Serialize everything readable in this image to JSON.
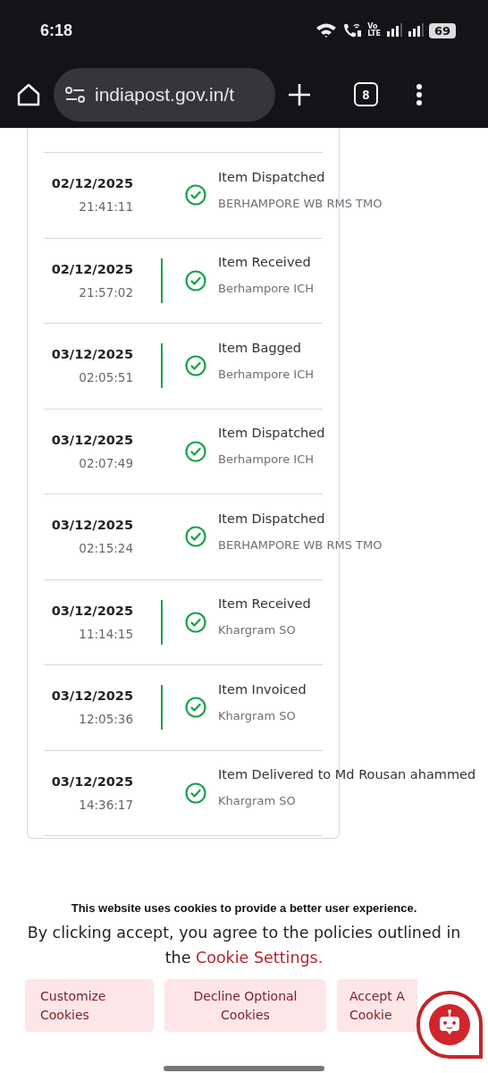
{
  "status_bar": {
    "time": "6:18",
    "volte_top": "Vo",
    "volte_bottom": "LTE",
    "battery": "69"
  },
  "browser": {
    "url": "indiapost.gov.in/t",
    "tab_count": "8"
  },
  "tracking": [
    {
      "date": "02/12/2025",
      "time": "21:41:11",
      "event": "Item Dispatched",
      "office": "BERHAMPORE WB RMS  TMO",
      "connector": false
    },
    {
      "date": "02/12/2025",
      "time": "21:57:02",
      "event": "Item Received",
      "office": "Berhampore ICH",
      "connector": true
    },
    {
      "date": "03/12/2025",
      "time": "02:05:51",
      "event": "Item Bagged",
      "office": "Berhampore ICH",
      "connector": true
    },
    {
      "date": "03/12/2025",
      "time": "02:07:49",
      "event": "Item Dispatched",
      "office": "Berhampore ICH",
      "connector": false
    },
    {
      "date": "03/12/2025",
      "time": "02:15:24",
      "event": "Item Dispatched",
      "office": "BERHAMPORE WB RMS  TMO",
      "connector": false
    },
    {
      "date": "03/12/2025",
      "time": "11:14:15",
      "event": "Item Received",
      "office": "Khargram SO",
      "connector": true
    },
    {
      "date": "03/12/2025",
      "time": "12:05:36",
      "event": "Item Invoiced",
      "office": "Khargram SO",
      "connector": true
    },
    {
      "date": "03/12/2025",
      "time": "14:36:17",
      "event": "Item Delivered to Md Rousan ahammed",
      "office": "Khargram SO",
      "connector": false
    }
  ],
  "cookie_banner": {
    "heading": "This website uses cookies to provide a better user experience.",
    "text": "By clicking accept, you agree to the policies outlined in the",
    "link": "Cookie Settings.",
    "buttons": [
      {
        "lines": [
          "Customize",
          "Cookies"
        ]
      },
      {
        "lines": [
          "Decline Optional",
          "Cookies"
        ]
      },
      {
        "lines": [
          "Accept A",
          "Cookie"
        ]
      }
    ]
  }
}
